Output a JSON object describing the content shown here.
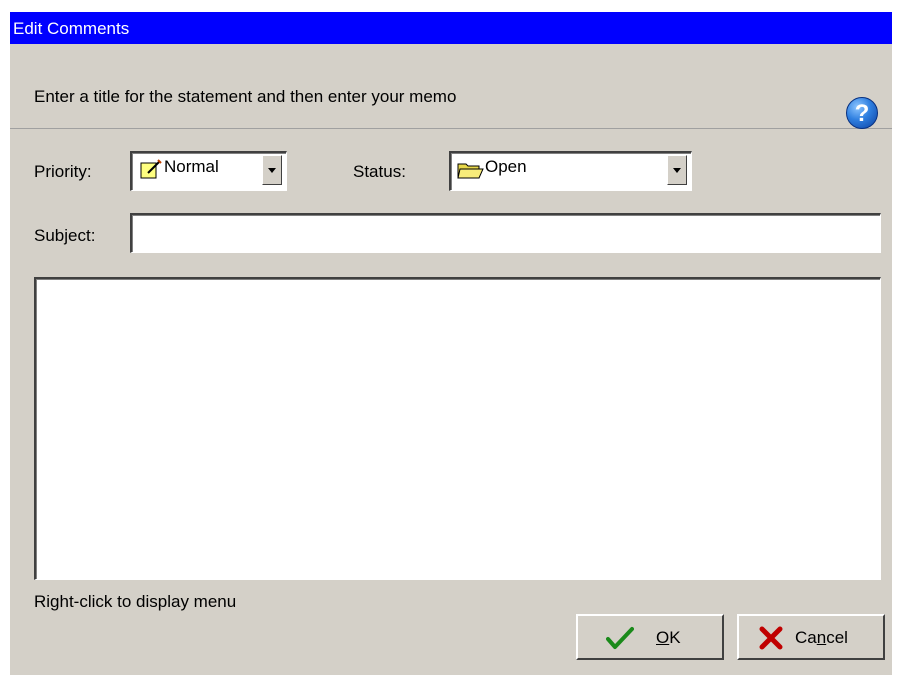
{
  "window": {
    "title": "Edit Comments"
  },
  "header": {
    "instruction": "Enter a title for the statement and then enter your memo",
    "help_glyph": "?"
  },
  "form": {
    "priority_label": "Priority:",
    "priority_value": "Normal",
    "status_label": "Status:",
    "status_value": "Open",
    "subject_label": "Subject:",
    "subject_value": "",
    "memo_value": ""
  },
  "hint": "Right-click to display menu",
  "buttons": {
    "ok_prefix": "",
    "ok_accel": "O",
    "ok_suffix": "K",
    "cancel_prefix": "Ca",
    "cancel_accel": "n",
    "cancel_suffix": "cel"
  },
  "colors": {
    "titlebar": "#0000ff",
    "dialog_bg": "#d4d0c8",
    "ok_check": "#1a8a1a",
    "cancel_x": "#c00000"
  },
  "icons": {
    "help": "help-icon",
    "priority": "memo-pencil-icon",
    "status": "folder-icon",
    "ok": "checkmark-icon",
    "cancel": "x-icon",
    "dropdown": "chevron-down-icon"
  }
}
